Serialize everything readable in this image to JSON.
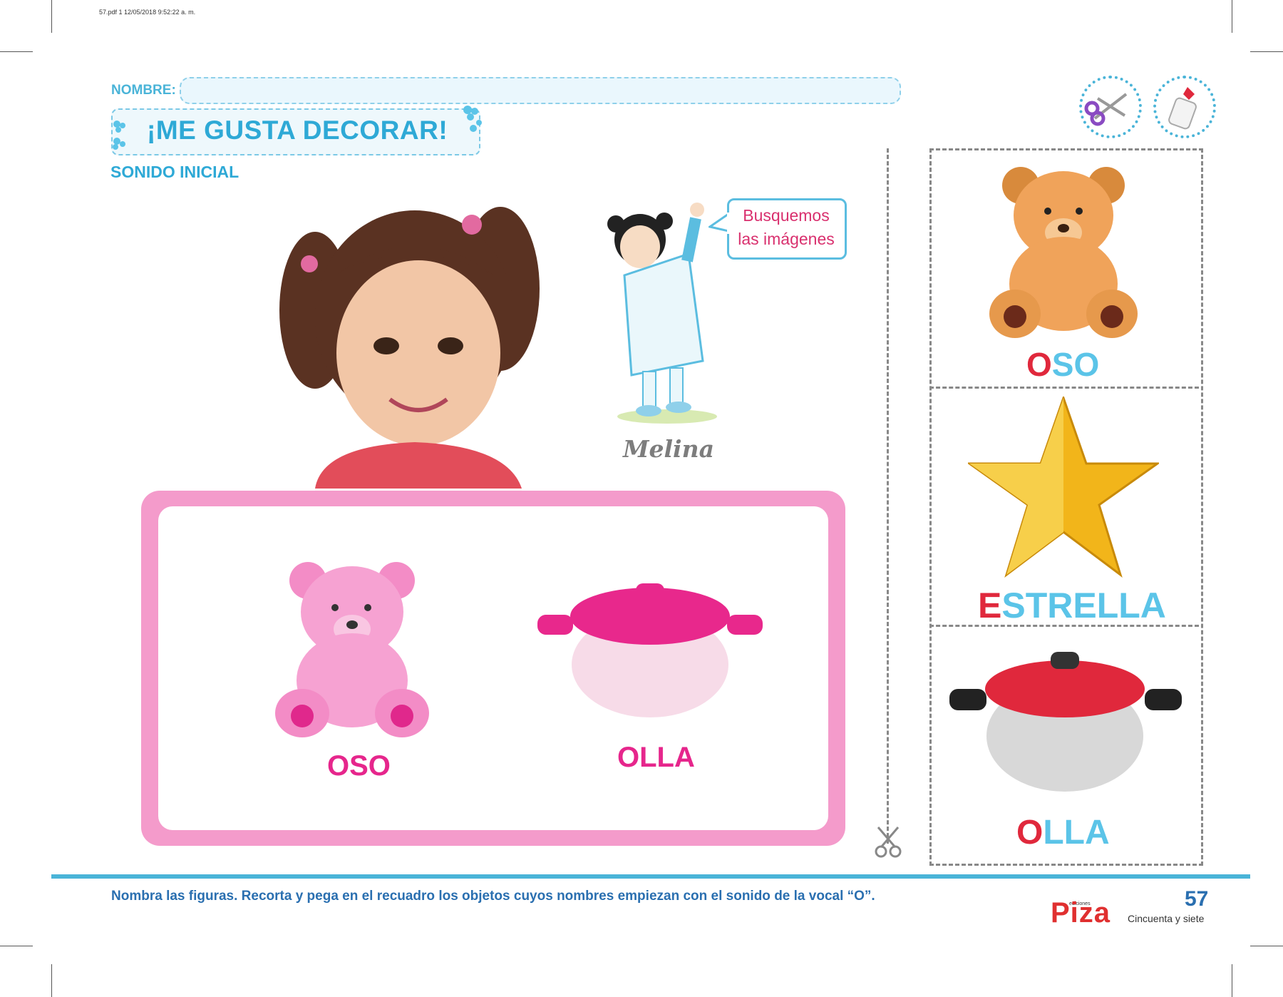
{
  "print_info": "57.pdf   1   12/05/2018   9:52:22 a. m.",
  "header": {
    "name_label": "NOMBRE:",
    "title": "¡ME GUSTA DECORAR!",
    "subtitle": "SONIDO INICIAL"
  },
  "tools": [
    {
      "icon": "scissors-icon"
    },
    {
      "icon": "glue-bottle-icon"
    }
  ],
  "character": {
    "speech_line1": "Busquemos",
    "speech_line2": "las imágenes",
    "name": "Melina"
  },
  "frame_items": [
    {
      "initial": "O",
      "rest": "SO",
      "icon": "pink-teddy-bear-icon"
    },
    {
      "initial": "O",
      "rest": "LLA",
      "icon": "pink-pot-icon"
    }
  ],
  "cutout_items": [
    {
      "initial": "O",
      "rest": "SO",
      "icon": "brown-teddy-bear-icon"
    },
    {
      "initial": "E",
      "rest": "STRELLA",
      "icon": "gold-star-icon"
    },
    {
      "initial": "O",
      "rest": "LLA",
      "icon": "red-pot-icon"
    }
  ],
  "footer": {
    "instruction": "Nombra las figuras. Recorta y pega en el recuadro los objetos cuyos nombres empiezan con el sonido de la vocal “O”.",
    "page_number": "57",
    "page_words": "Cincuenta y siete",
    "publisher_small": "ediciones",
    "publisher": "Piza"
  },
  "colors": {
    "accent_blue": "#2ea9d6",
    "initial_red": "#e0283c",
    "word_blue": "#5bc4e8",
    "frame_pink": "#f49bcb",
    "word_pink": "#e6268c"
  }
}
